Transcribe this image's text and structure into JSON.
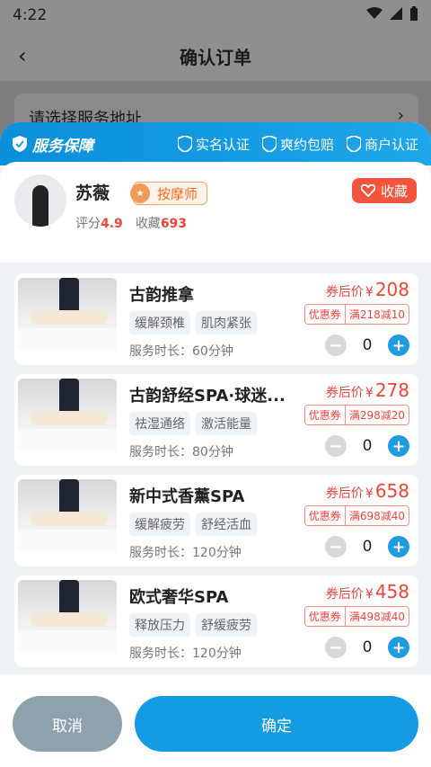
{
  "status": {
    "time": "4:22"
  },
  "header": {
    "title": "确认订单"
  },
  "address": {
    "label": "请选择服务地址"
  },
  "guarantee": {
    "brand": "服务保障",
    "items": [
      "实名认证",
      "爽约包赔",
      "商户认证"
    ]
  },
  "therapist": {
    "name": "苏薇",
    "role": "按摩师",
    "rating_label": "评分",
    "rating": "4.9",
    "fav_label": "收藏",
    "fav_count": "693",
    "fav_button": "收藏"
  },
  "services": [
    {
      "title": "古韵推拿",
      "tags": [
        "缓解颈椎",
        "肌肉紧张"
      ],
      "duration": "服务时长：60分钟",
      "price_label": "券后价",
      "currency": "¥",
      "price": "208",
      "coupon_label": "优惠券",
      "coupon_rule": "满218减10",
      "qty": "0"
    },
    {
      "title": "古韵舒经SPA·球迷...",
      "tags": [
        "祛湿通络",
        "激活能量"
      ],
      "duration": "服务时长：80分钟",
      "price_label": "券后价",
      "currency": "¥",
      "price": "278",
      "coupon_label": "优惠券",
      "coupon_rule": "满298减20",
      "qty": "0"
    },
    {
      "title": "新中式香薰SPA",
      "tags": [
        "缓解疲劳",
        "舒经活血"
      ],
      "duration": "服务时长：120分钟",
      "price_label": "券后价",
      "currency": "¥",
      "price": "658",
      "coupon_label": "优惠券",
      "coupon_rule": "满698减40",
      "qty": "0"
    },
    {
      "title": "欧式奢华SPA",
      "tags": [
        "释放压力",
        "舒缓疲劳"
      ],
      "duration": "服务时长：120分钟",
      "price_label": "券后价",
      "currency": "¥",
      "price": "458",
      "coupon_label": "优惠券",
      "coupon_rule": "满498减40",
      "qty": "0"
    }
  ],
  "footer": {
    "cancel": "取消",
    "confirm": "确定"
  },
  "colors": {
    "accent": "#149be1",
    "price": "#e8463a",
    "cancel": "#8ea2ad"
  }
}
